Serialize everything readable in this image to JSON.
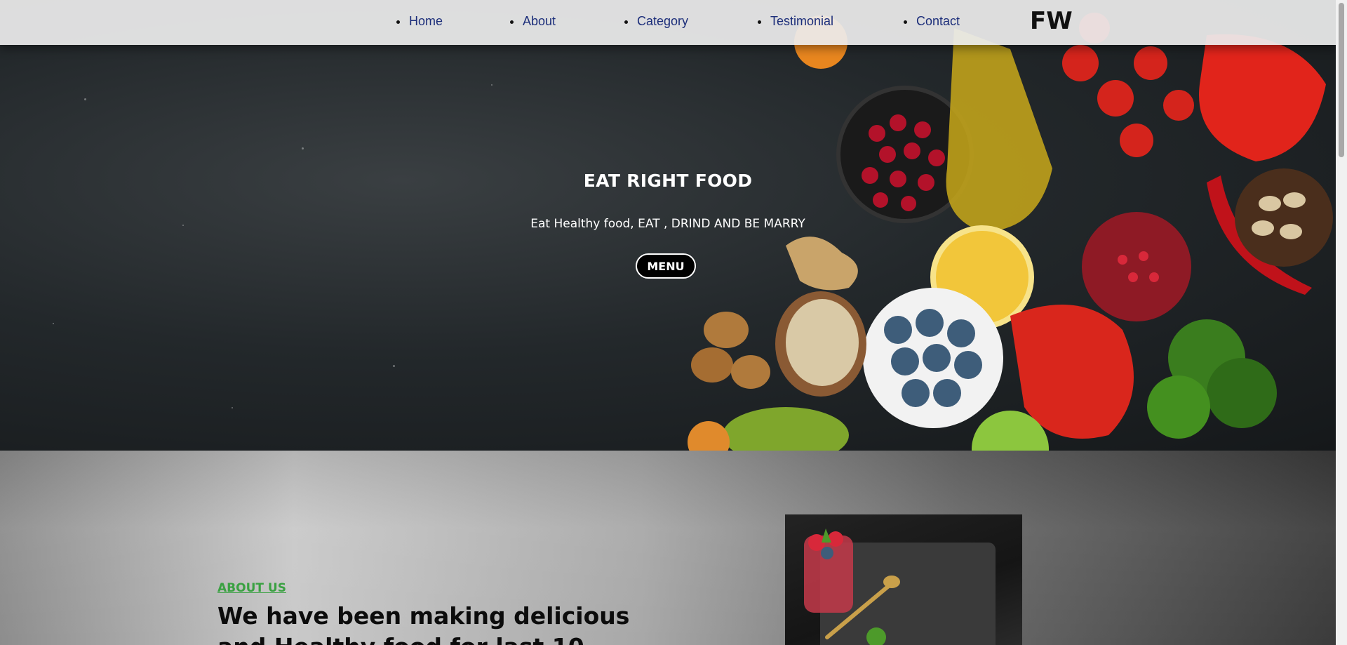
{
  "nav": {
    "items": [
      {
        "label": "Home"
      },
      {
        "label": "About"
      },
      {
        "label": "Category"
      },
      {
        "label": "Testimonial"
      },
      {
        "label": "Contact"
      }
    ],
    "logo": "FW"
  },
  "hero": {
    "title": "EAT RIGHT FOOD",
    "subtitle": "Eat Healthy food, EAT , DRIND AND BE MARRY",
    "button_label": "MENU"
  },
  "about": {
    "label": "ABOUT US",
    "heading": "We have been making delicious and Healthy food for last 10"
  },
  "colors": {
    "nav_link": "#1c2e7a",
    "accent_green": "#3aa142",
    "hero_bg": "#23282b"
  }
}
